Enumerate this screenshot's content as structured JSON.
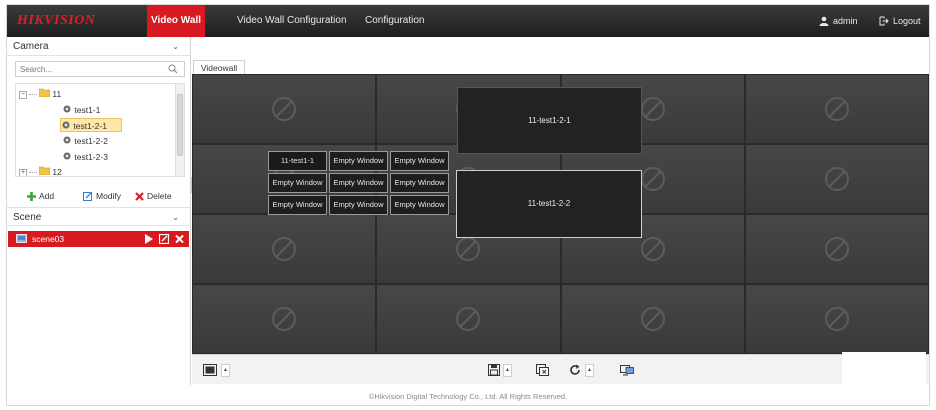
{
  "brand": "HIKVISION",
  "nav": {
    "video_wall": "Video Wall",
    "video_wall_configuration": "Video Wall Configuration",
    "configuration": "Configuration"
  },
  "user": {
    "name": "admin",
    "logout": "Logout"
  },
  "camera_panel": {
    "title": "Camera",
    "search_placeholder": "Search...",
    "tree": [
      {
        "label": "11",
        "type": "group",
        "expanded": true
      },
      {
        "label": "test1-1",
        "type": "camera"
      },
      {
        "label": "test1-2-1",
        "type": "camera",
        "selected": true
      },
      {
        "label": "test1-2-2",
        "type": "camera"
      },
      {
        "label": "test1-2-3",
        "type": "camera"
      },
      {
        "label": "12",
        "type": "group",
        "expanded": false
      }
    ],
    "actions": {
      "add": "Add",
      "modify": "Modify",
      "delete": "Delete"
    }
  },
  "scene_panel": {
    "title": "Scene",
    "scenes": [
      {
        "label": "scene03",
        "active": true
      }
    ]
  },
  "tabs": [
    {
      "label": "Videowall",
      "active": true
    }
  ],
  "wall": {
    "rows": 4,
    "cols": 4,
    "split_grid": [
      [
        "11-test1-1",
        "Empty Window",
        "Empty Window"
      ],
      [
        "Empty Window",
        "Empty Window",
        "Empty Window"
      ],
      [
        "Empty Window",
        "Empty Window",
        "Empty Window"
      ]
    ],
    "windows": [
      {
        "label": "11-test1-2-1",
        "selected": true
      },
      {
        "label": "11-test1-2-2",
        "selected": false
      }
    ]
  },
  "colors": {
    "accent_red": "#d71920",
    "topbar": "#2b2b2b",
    "selected_border": "#c62828",
    "tree_selected": "#fde8a8"
  },
  "icons": [
    "user-icon",
    "logout-icon",
    "search-icon",
    "folder-icon",
    "camera-icon",
    "add-icon",
    "modify-icon",
    "delete-icon",
    "scene-icon",
    "play-icon",
    "edit-icon",
    "close-icon",
    "no-signal-icon",
    "screen-layout-icon",
    "save-icon",
    "clear-windows-icon",
    "refresh-icon",
    "monitor-icon"
  ],
  "footer": "©Hikvision Digital Technology Co., Ltd. All Rights Reserved."
}
